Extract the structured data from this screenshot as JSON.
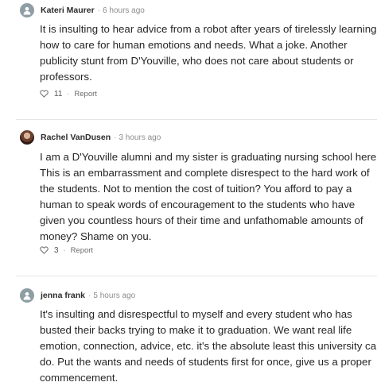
{
  "comments": [
    {
      "author": "Kateri Maurer",
      "time": "6 hours ago",
      "lines": [
        "It is insulting to hear advice from a robot after years of tirelessly learning",
        "how to care for human emotions and needs. What a joke. Another",
        "publicity stunt from D'Youville, who does not care about students or",
        "professors."
      ],
      "likes": "11",
      "report_label": "Report",
      "separator": "·"
    },
    {
      "author": "Rachel VanDusen",
      "time": "3 hours ago",
      "lines": [
        "I am a D'Youville alumni and my sister is graduating nursing school here.",
        "This is an embarrassment and complete disrespect to the hard work of",
        "the students. Not to mention the cost of tuition? You afford to pay a",
        "human to speak words of encouragement to the students who have",
        "given you countless hours of their time and unfathomable amounts of",
        "money? Shame on you."
      ],
      "likes": "3",
      "report_label": "Report",
      "separator": "·"
    },
    {
      "author": "jenna frank",
      "time": "5 hours ago",
      "lines": [
        "It's insulting and disrespectful to myself and every student who has",
        "busted their backs trying to make it to graduation. We want real life",
        "emotion, connection, advice, etc. it's the absolute least this university can",
        "do. Put the wants and needs of students first for once, give us a proper",
        "commencement."
      ],
      "separator": "·"
    }
  ],
  "icons": {
    "like": "heart-outline-icon",
    "avatar": "person-icon"
  },
  "colors": {
    "avatar_generic": "#8f9da5",
    "divider": "#e4e4e4"
  }
}
